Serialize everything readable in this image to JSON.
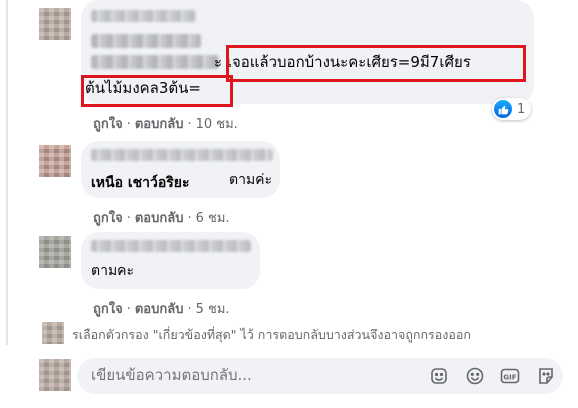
{
  "comments": [
    {
      "text_visible_a": "ะ เจอแล้วบอกบ้างนะคะเศียร=9มี7เศียร",
      "text_visible_b": "ต้นไม้มงคล3ต้น=",
      "actions": {
        "like": "ถูกใจ",
        "reply": "ตอบกลับ",
        "time": "10 ชม."
      },
      "reaction_count": "1"
    },
    {
      "tagged_name": "เหนือ เชาว์อริยะ",
      "text": "ตามค่ะ",
      "actions": {
        "like": "ถูกใจ",
        "reply": "ตอบกลับ",
        "time": "6 ชม."
      }
    },
    {
      "text": "ตามคะ",
      "actions": {
        "like": "ถูกใจ",
        "reply": "ตอบกลับ",
        "time": "5 ชม."
      }
    }
  ],
  "filter_notice": "รเลือกตัวกรอง \"เกี่ยวข้องที่สุด\" ไว้ การตอบกลับบางส่วนจึงอาจถูกกรองออก",
  "reply_box": {
    "placeholder": "เขียนข้อความตอบกลับ..."
  },
  "colors": {
    "bubble": "#f0f2f5",
    "highlight": "#e0161e",
    "muted": "#65676b",
    "like_blue": "#0165e1"
  },
  "icons": [
    "like-reaction-icon",
    "emoji-sticker-icon",
    "smiley-icon",
    "gif-icon",
    "sticker-icon"
  ]
}
